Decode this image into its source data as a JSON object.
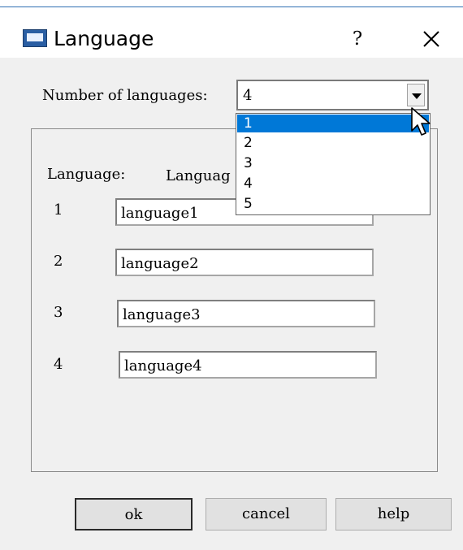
{
  "window": {
    "title": "Language",
    "help_label": "?",
    "close_label": "×"
  },
  "count": {
    "label": "Number of languages:",
    "value": "4",
    "options": [
      "1",
      "2",
      "3",
      "4",
      "5"
    ],
    "highlighted": "1"
  },
  "group": {
    "header_language": "Language:",
    "header_column": "Languag"
  },
  "rows": [
    {
      "num": "1",
      "value": "language1"
    },
    {
      "num": "2",
      "value": "language2"
    },
    {
      "num": "3",
      "value": "language3"
    },
    {
      "num": "4",
      "value": "language4"
    }
  ],
  "buttons": {
    "ok": "ok",
    "cancel": "cancel",
    "help": "help"
  },
  "colors": {
    "selection": "#0078d7",
    "dialog_bg": "#f0f0f0",
    "title_icon": "#2a5ea3"
  },
  "icons": {
    "app": "window-icon",
    "close": "close-icon",
    "cursor": "mouse-pointer-icon"
  }
}
